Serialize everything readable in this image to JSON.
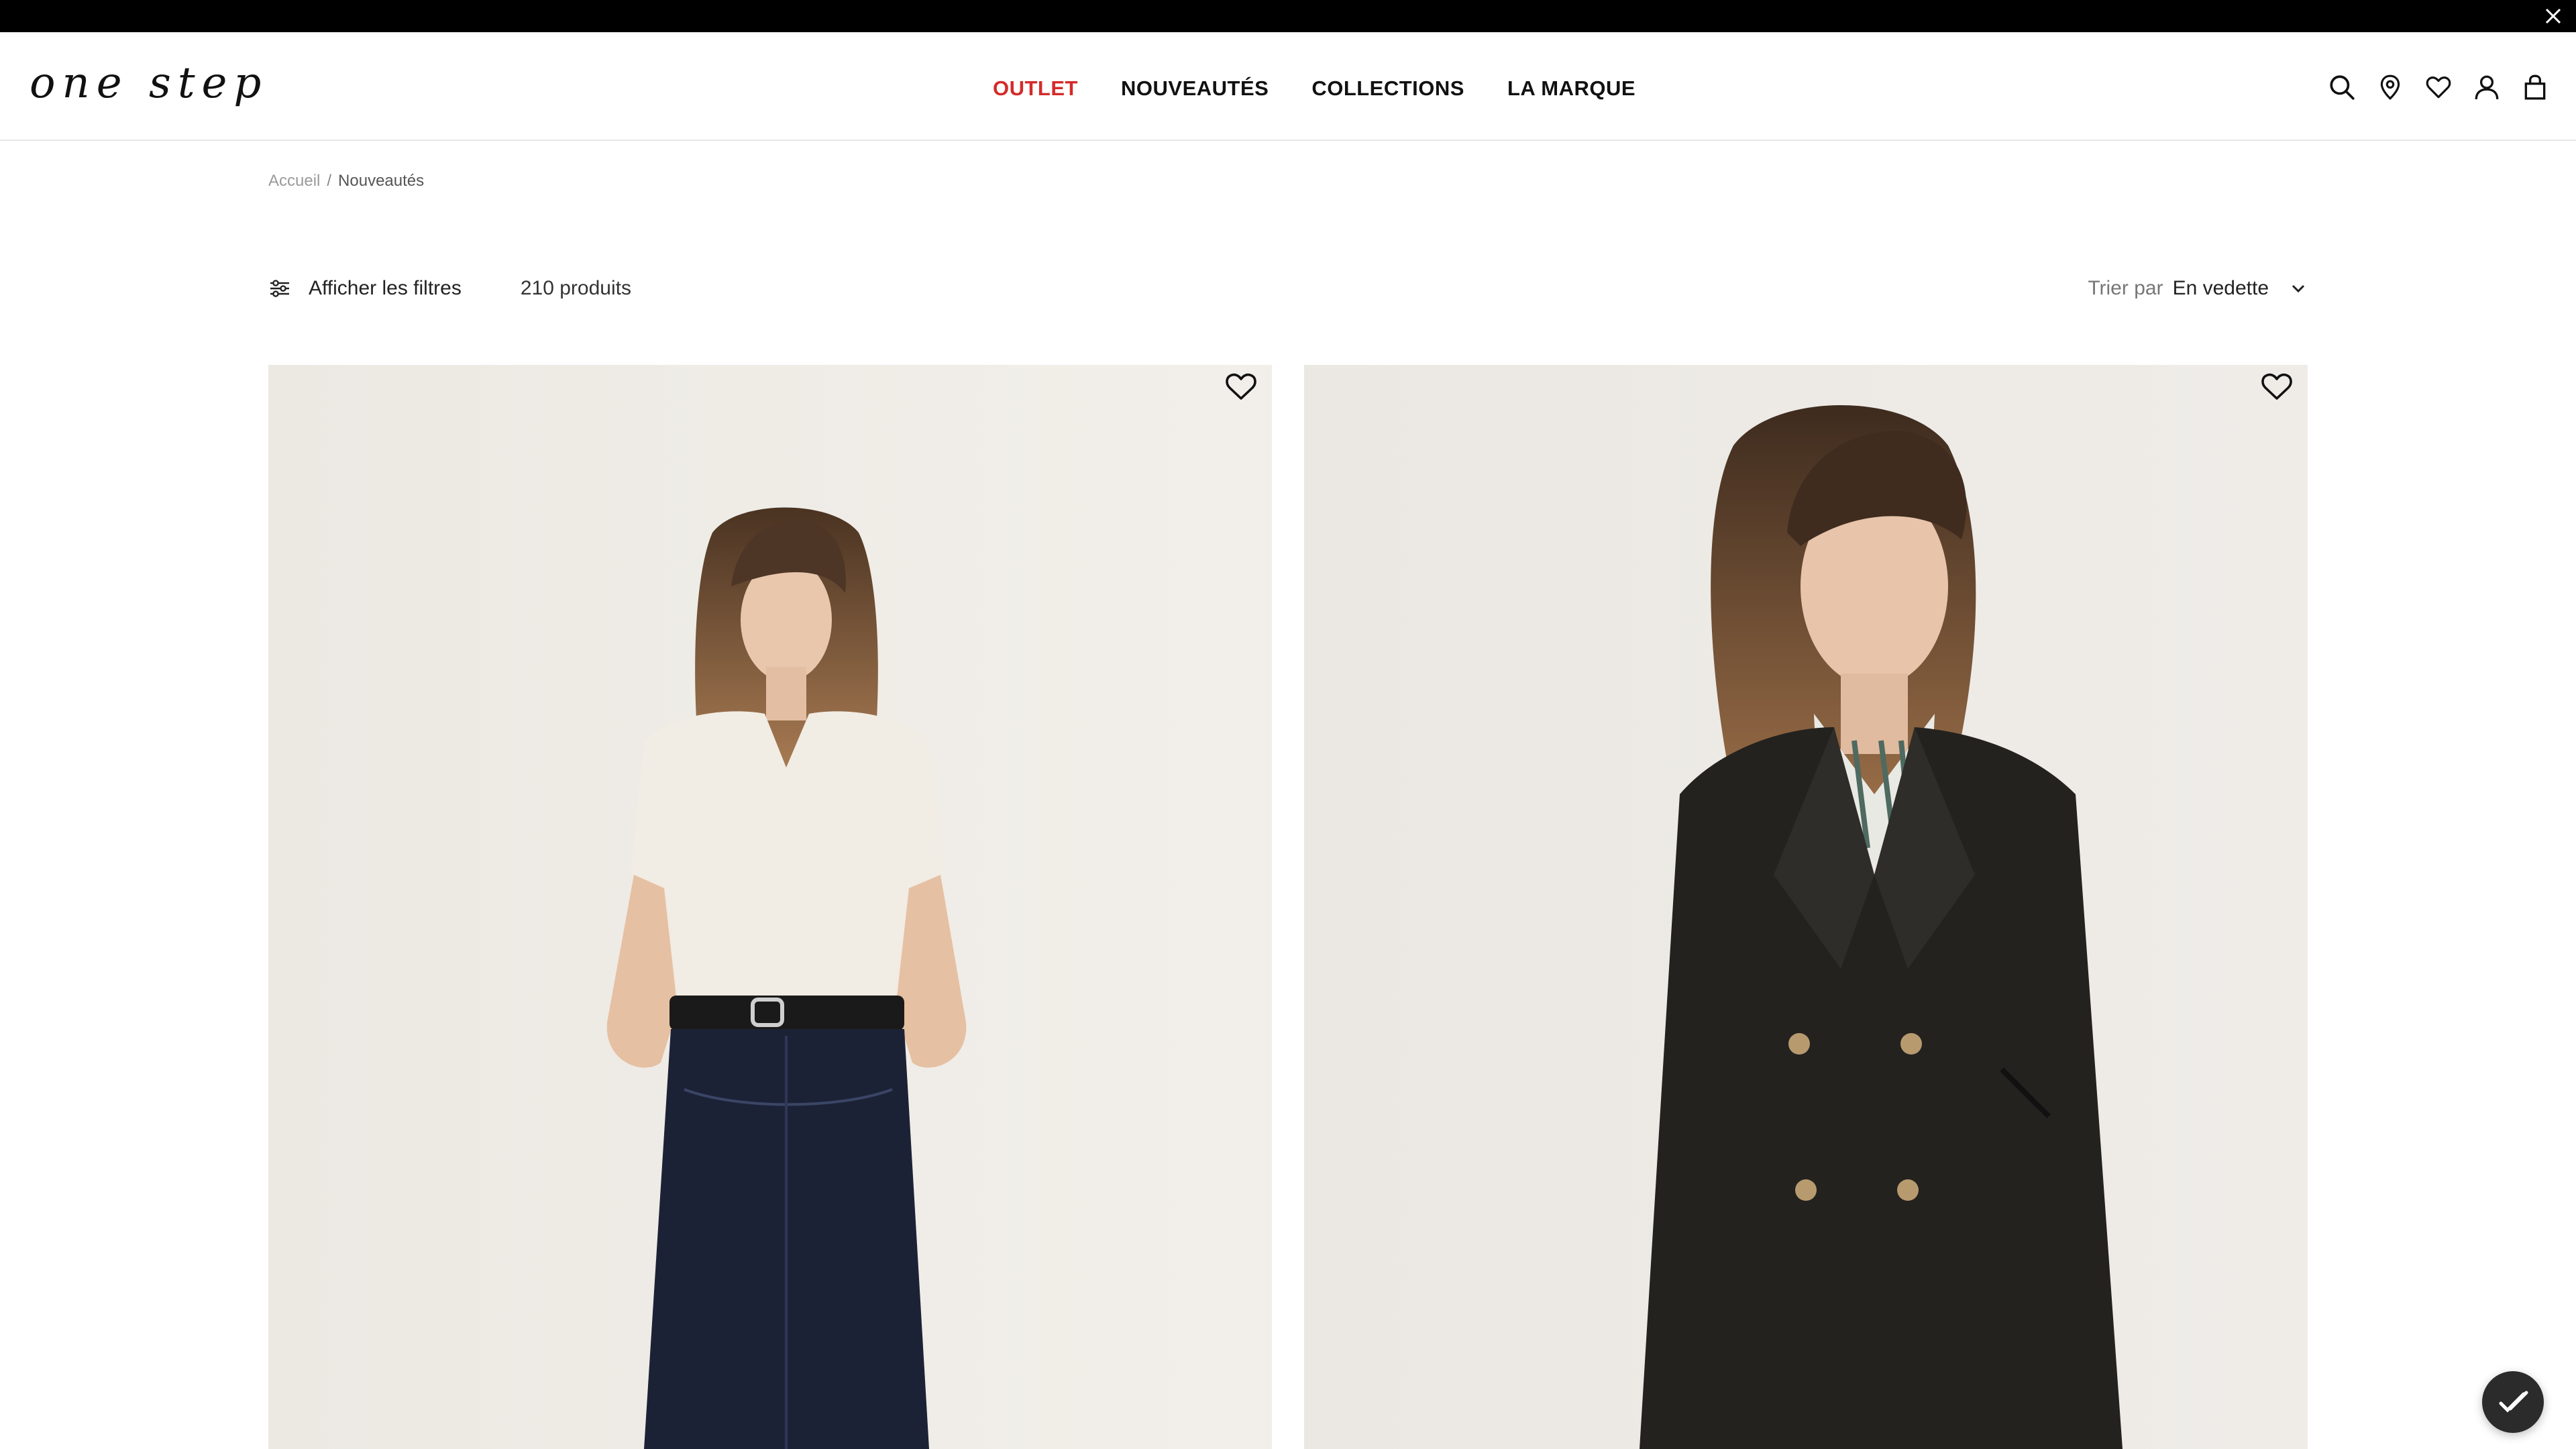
{
  "topbar": {
    "close_icon": "close-icon"
  },
  "header": {
    "logo_text": "one step",
    "nav": [
      {
        "label": "OUTLET",
        "accent": true
      },
      {
        "label": "NOUVEAUTÉS",
        "accent": false
      },
      {
        "label": "COLLECTIONS",
        "accent": false
      },
      {
        "label": "LA MARQUE",
        "accent": false
      }
    ],
    "icons": [
      "search-icon",
      "store-locator-icon",
      "wishlist-icon",
      "account-icon",
      "bag-icon"
    ],
    "accent_color": "#d42a2a"
  },
  "breadcrumb": {
    "home": "Accueil",
    "separator": "/",
    "current": "Nouveautés"
  },
  "toolbar": {
    "filters_label": "Afficher les filtres",
    "product_count": "210 produits",
    "sort_label": "Trier par",
    "sort_value": "En vedette"
  },
  "products": [
    {
      "image": "model-white-tee-denim-skirt",
      "wishlist_icon": "heart-icon"
    },
    {
      "image": "model-black-double-breasted-coat",
      "wishlist_icon": "heart-icon"
    }
  ]
}
